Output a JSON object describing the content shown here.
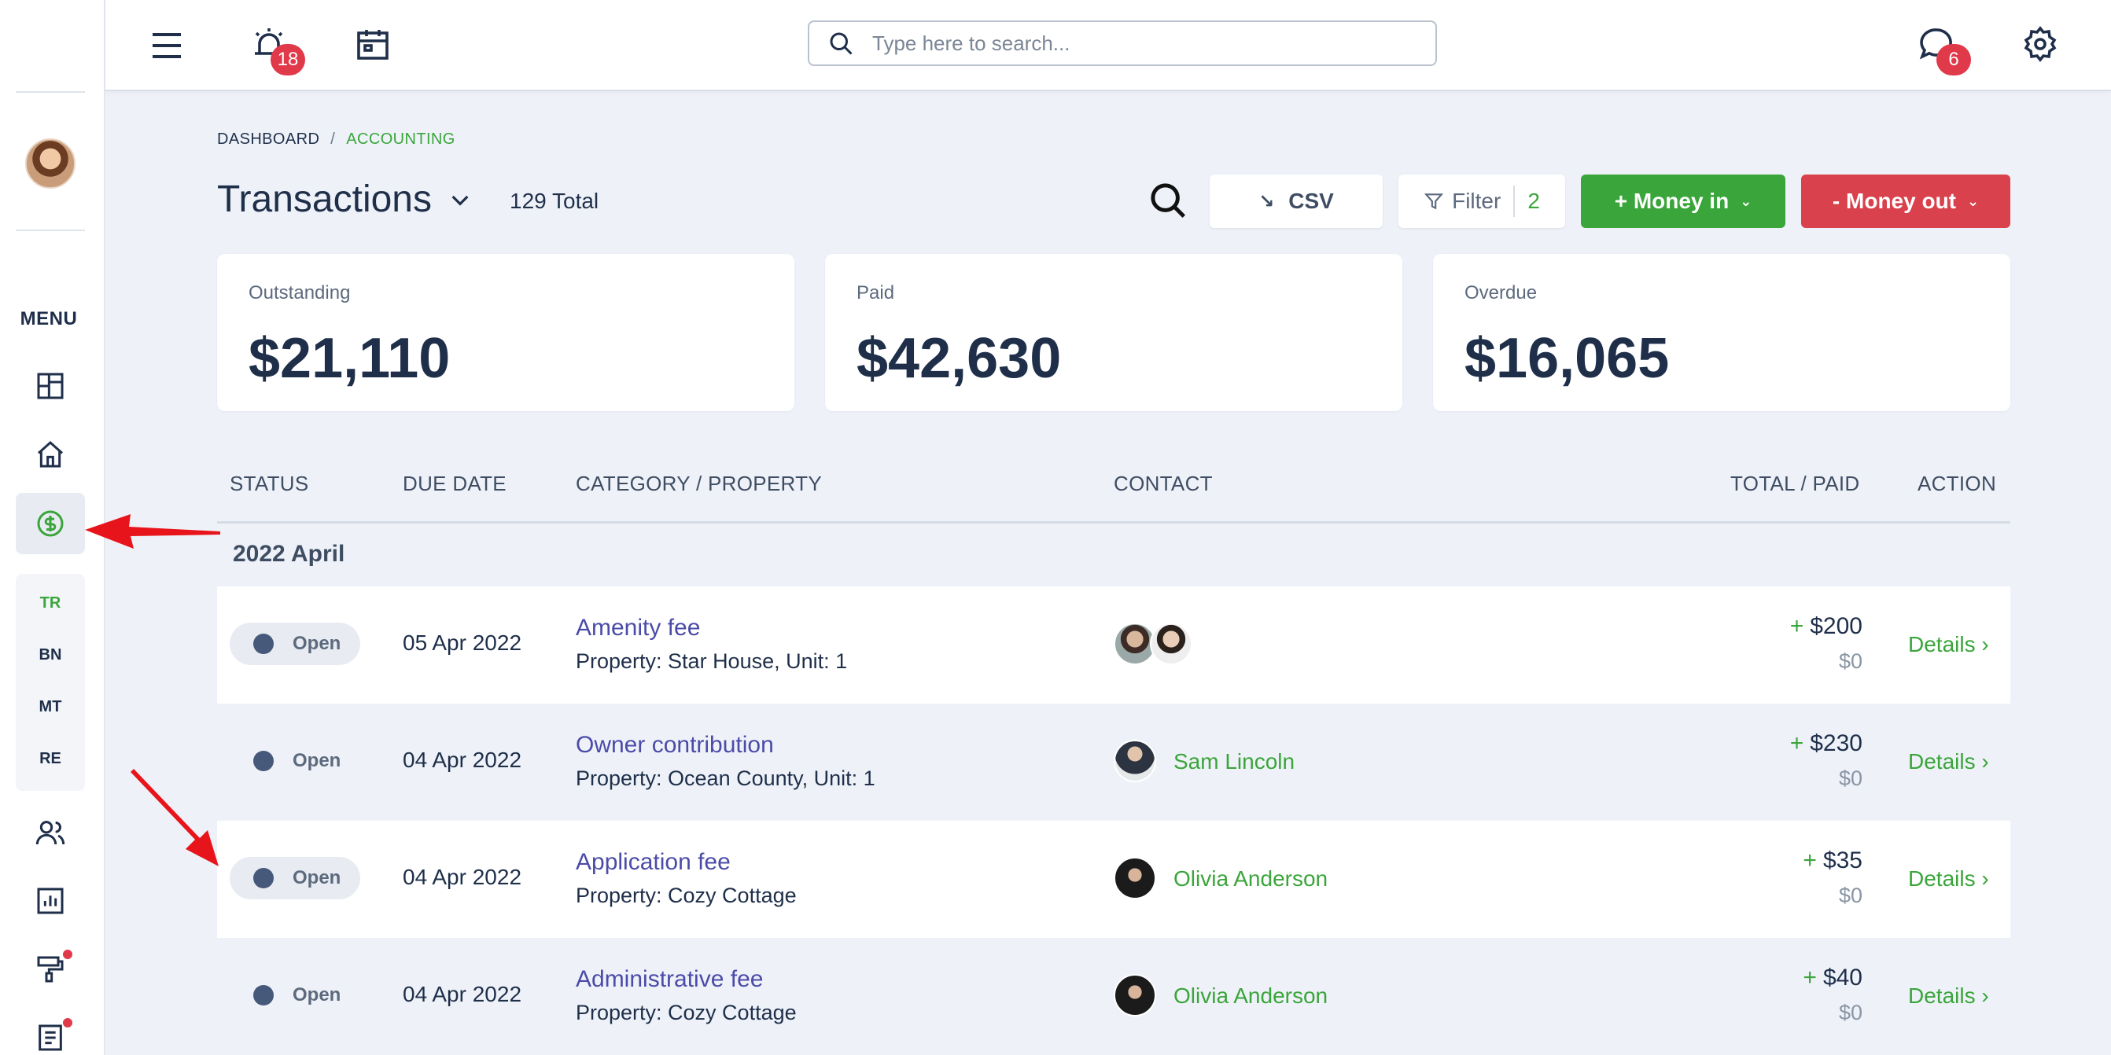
{
  "topbar": {
    "alerts_badge": "18",
    "messages_badge": "6",
    "search_placeholder": "Type here to search..."
  },
  "sidebar": {
    "menu_label": "MENU",
    "sub_items": [
      "TR",
      "BN",
      "MT",
      "RE"
    ]
  },
  "breadcrumb": {
    "items": [
      "DASHBOARD",
      "ACCOUNTING"
    ],
    "separator": "/"
  },
  "page": {
    "title": "Transactions",
    "total": "129 Total"
  },
  "actions": {
    "csv_label": "CSV",
    "filter_label": "Filter",
    "filter_count": "2",
    "money_in_label": "+ Money in",
    "money_out_label": "- Money out"
  },
  "summary": [
    {
      "label": "Outstanding",
      "value": "$21,110"
    },
    {
      "label": "Paid",
      "value": "$42,630"
    },
    {
      "label": "Overdue",
      "value": "$16,065"
    }
  ],
  "table": {
    "columns": [
      "STATUS",
      "DUE DATE",
      "CATEGORY / PROPERTY",
      "CONTACT",
      "TOTAL / PAID",
      "ACTION"
    ],
    "group": "2022 April",
    "rows": [
      {
        "status": "Open",
        "due": "05 Apr 2022",
        "category": "Amenity fee",
        "property": "Property: Star House, Unit: 1",
        "contact": "",
        "total": "$200",
        "paid": "$0",
        "action": "Details ›"
      },
      {
        "status": "Open",
        "due": "04 Apr 2022",
        "category": "Owner contribution",
        "property": "Property: Ocean County, Unit: 1",
        "contact": "Sam Lincoln",
        "total": "$230",
        "paid": "$0",
        "action": "Details ›"
      },
      {
        "status": "Open",
        "due": "04 Apr 2022",
        "category": "Application fee",
        "property": "Property: Cozy Cottage",
        "contact": "Olivia Anderson",
        "total": "$35",
        "paid": "$0",
        "action": "Details ›"
      },
      {
        "status": "Open",
        "due": "04 Apr 2022",
        "category": "Administrative fee",
        "property": "Property: Cozy Cottage",
        "contact": "Olivia Anderson",
        "total": "$40",
        "paid": "$0",
        "action": "Details ›"
      }
    ],
    "plus_sign": "+"
  },
  "colors": {
    "accent_green": "#3aa53a",
    "danger_red": "#d9414c",
    "link_purple": "#4b4ba8",
    "annotation_red": "#e8141b"
  }
}
